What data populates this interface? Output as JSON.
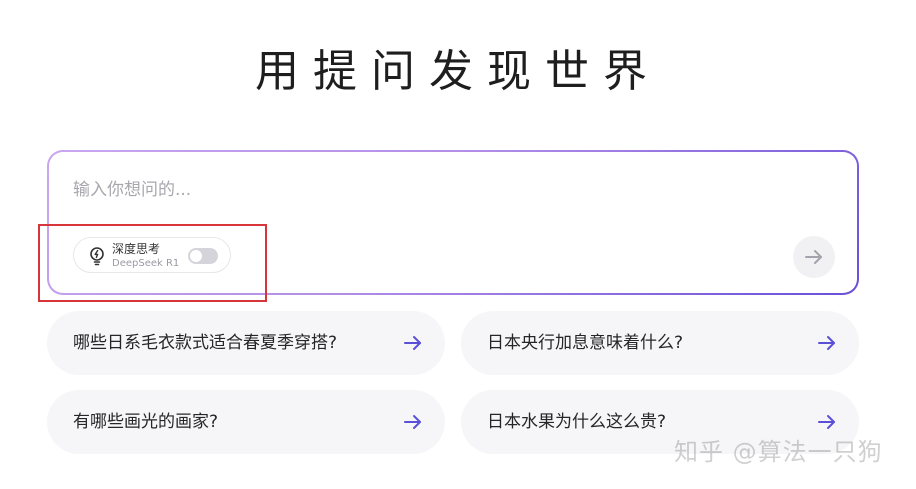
{
  "hero": {
    "title": "用提问发现世界"
  },
  "ask_box": {
    "placeholder": "输入你想问的...",
    "deep_think": {
      "label": "深度思考",
      "model": "DeepSeek R1",
      "enabled": false
    },
    "send_icon": "arrow-right-icon"
  },
  "suggestions": [
    {
      "text": "哪些日系毛衣款式适合春夏季穿搭?"
    },
    {
      "text": "日本央行加息意味着什么?"
    },
    {
      "text": "有哪些画光的画家?"
    },
    {
      "text": "日本水果为什么这么贵?"
    }
  ],
  "watermark": {
    "text": "知乎 @算法一只狗"
  },
  "colors": {
    "accent": "#5b4fd8",
    "gradient_start": "#c9a7f0",
    "gradient_end": "#6a4fd8",
    "highlight": "#d8353a",
    "suggestion_bg": "#f6f6f8"
  }
}
